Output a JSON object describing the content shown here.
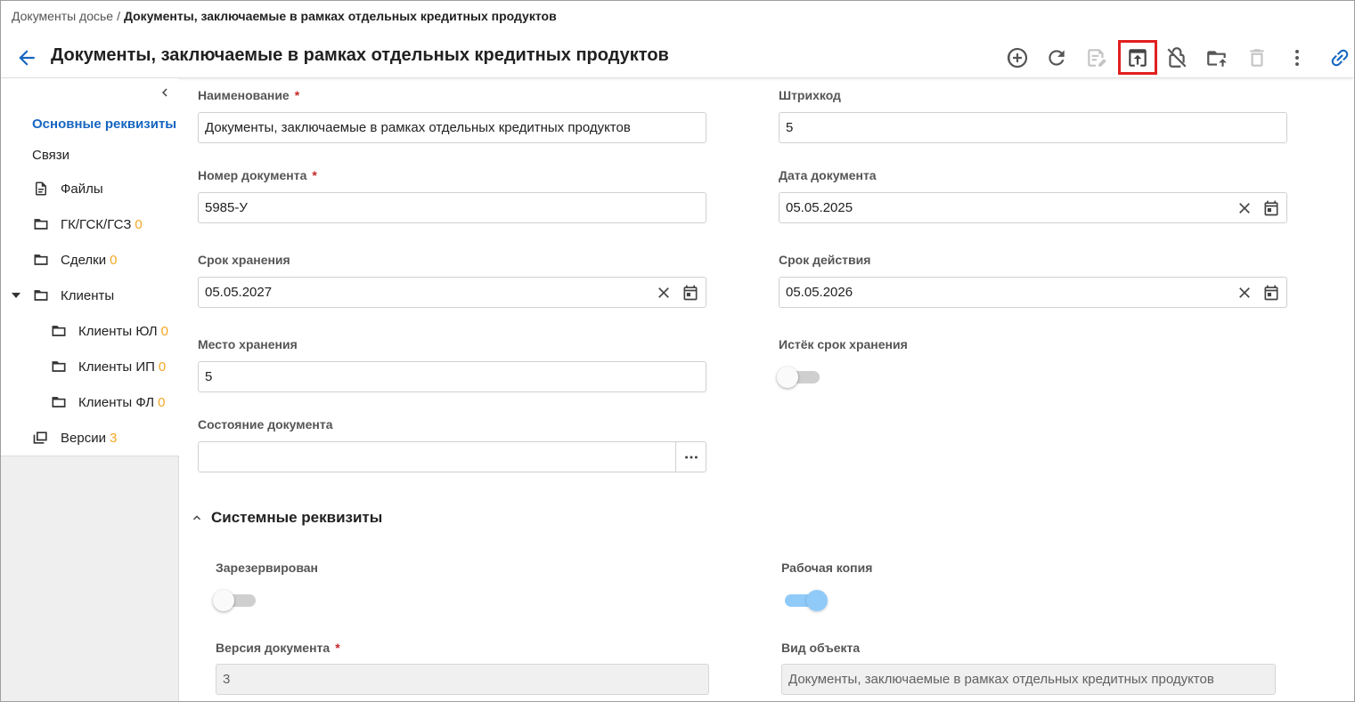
{
  "breadcrumb": {
    "parent": "Документы досье",
    "separator": "/",
    "current": "Документы, заключаемые в рамках отдельных кредитных продуктов"
  },
  "page": {
    "title": "Документы, заключаемые в рамках отдельных кредитных продуктов"
  },
  "toolbar": {
    "icons": [
      "add-circle-icon",
      "refresh-icon",
      "edit-document-icon",
      "publish-icon",
      "lock-off-icon",
      "folder-upload-icon",
      "delete-icon",
      "more-vertical-icon",
      "link-icon"
    ],
    "highlighted": "publish-icon"
  },
  "sidebar": {
    "items": [
      {
        "label": "Основные реквизиты",
        "count": "",
        "icon": "",
        "active": true
      },
      {
        "label": "Связи",
        "count": "",
        "icon": ""
      },
      {
        "label": "Файлы",
        "count": "",
        "icon": "file-icon"
      },
      {
        "label": "ГК/ГСК/ГСЗ",
        "count": "0",
        "icon": "folder-icon"
      },
      {
        "label": "Сделки",
        "count": "0",
        "icon": "folder-icon"
      },
      {
        "label": "Клиенты",
        "count": "",
        "icon": "folder-icon",
        "expanded": true
      },
      {
        "label": "Клиенты ЮЛ",
        "count": "0",
        "icon": "folder-icon"
      },
      {
        "label": "Клиенты ИП",
        "count": "0",
        "icon": "folder-icon"
      },
      {
        "label": "Клиенты ФЛ",
        "count": "0",
        "icon": "folder-icon"
      },
      {
        "label": "Версии",
        "count": "3",
        "icon": "versions-icon"
      }
    ],
    "accent_color": "#1565c0",
    "count_color": "#f5a623"
  },
  "form": {
    "name": {
      "label": "Наименование",
      "value": "Документы, заключаемые в рамках отдельных кредитных продуктов",
      "required": "*"
    },
    "barcode": {
      "label": "Штрихкод",
      "value": "5"
    },
    "doc_number": {
      "label": "Номер документа",
      "value": "5985-У",
      "required": "*"
    },
    "doc_date": {
      "label": "Дата документа",
      "value": "05.05.2025"
    },
    "storage_term": {
      "label": "Срок хранения",
      "value": "05.05.2027"
    },
    "validity_term": {
      "label": "Срок действия",
      "value": "05.05.2026"
    },
    "storage_place": {
      "label": "Место хранения",
      "value": "5"
    },
    "storage_expired": {
      "label": "Истёк срок хранения",
      "on": false
    },
    "doc_state": {
      "label": "Состояние документа",
      "value": ""
    }
  },
  "system": {
    "section_title": "Системные реквизиты",
    "reserved": {
      "label": "Зарезервирован",
      "on": false
    },
    "working_copy": {
      "label": "Рабочая копия",
      "on": true
    },
    "doc_version": {
      "label": "Версия документа",
      "value": "3",
      "required": "*"
    },
    "object_type": {
      "label": "Вид объекта",
      "value": "Документы, заключаемые в рамках отдельных кредитных продуктов"
    }
  }
}
